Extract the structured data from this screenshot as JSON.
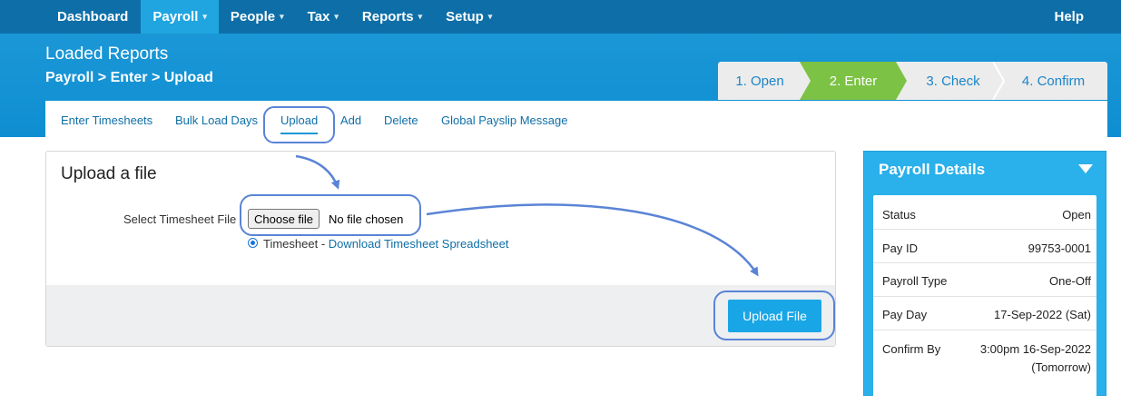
{
  "topnav": {
    "items": [
      {
        "label": "Dashboard",
        "has_menu": false
      },
      {
        "label": "Payroll",
        "has_menu": true,
        "active": true
      },
      {
        "label": "People",
        "has_menu": true
      },
      {
        "label": "Tax",
        "has_menu": true
      },
      {
        "label": "Reports",
        "has_menu": true
      },
      {
        "label": "Setup",
        "has_menu": true
      }
    ],
    "help": "Help",
    "caret": "▾"
  },
  "header": {
    "title": "Loaded Reports",
    "breadcrumb": "Payroll > Enter > Upload"
  },
  "wizard": {
    "steps": [
      "1. Open",
      "2. Enter",
      "3. Check",
      "4. Confirm"
    ],
    "active_index": 1
  },
  "subnav": {
    "links": [
      "Enter Timesheets",
      "Bulk Load Days",
      "Upload",
      "Add",
      "Delete",
      "Global Payslip Message"
    ],
    "active": "Upload"
  },
  "upload": {
    "title": "Upload a file",
    "field_label": "Select Timesheet File",
    "choose_button": "Choose file",
    "no_file_text": "No file chosen",
    "radio_label": "Timesheet - ",
    "download_link": "Download Timesheet Spreadsheet",
    "upload_button": "Upload File"
  },
  "payroll_details": {
    "title": "Payroll Details",
    "rows": [
      {
        "label": "Status",
        "value": "Open"
      },
      {
        "label": "Pay ID",
        "value": "99753-0001"
      },
      {
        "label": "Payroll Type",
        "value": "One-Off"
      },
      {
        "label": "Pay Day",
        "value": "17-Sep-2022 (Sat)"
      },
      {
        "label": "Confirm By",
        "value": "3:00pm 16-Sep-2022",
        "value2": "(Tomorrow)"
      }
    ]
  },
  "colors": {
    "nav_bg": "#0e6fa8",
    "nav_active": "#20a5e0",
    "band": "#1b97d6",
    "step_active": "#7cc244",
    "link": "#0f6fa8",
    "button": "#18a6e6",
    "annotation": "#5a84d6"
  }
}
